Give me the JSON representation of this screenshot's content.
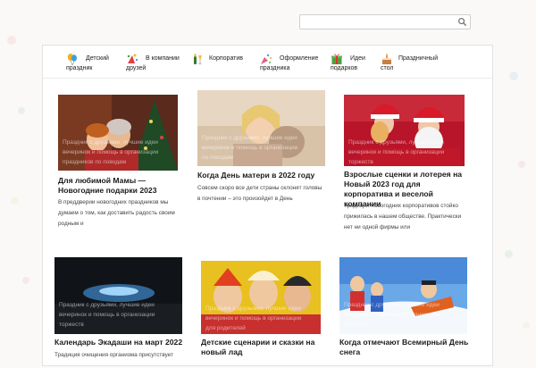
{
  "search": {
    "placeholder": "",
    "value": ""
  },
  "nav": [
    {
      "l1": "Детский",
      "l2": "праздник",
      "icon": "balloon-icon"
    },
    {
      "l1": "В компании",
      "l2": "друзей",
      "icon": "party-icon"
    },
    {
      "l1": "Корпоратив",
      "l2": "",
      "icon": "champagne-icon"
    },
    {
      "l1": "Оформление",
      "l2": "праздника",
      "icon": "confetti-icon"
    },
    {
      "l1": "Идеи",
      "l2": "подарков",
      "icon": "gift-icon"
    },
    {
      "l1": "Праздничный",
      "l2": "стол",
      "icon": "cake-icon"
    }
  ],
  "cards": [
    {
      "title1": "Для любимой Мамы —",
      "title2": "Новогодние подарки 2023",
      "title3": "",
      "exc1": "В преддверии новогодних праздников мы",
      "exc2": "думаем о том, как доставить радость своим",
      "exc3": "родным и",
      "ov1": "Праздник с друзьями, лучшие идеи",
      "ov2": "вечеринок и помощь в организации",
      "ov3": "праздников по поводам"
    },
    {
      "title1": "Когда День матери в 2022 году",
      "title2": "",
      "title3": "",
      "exc1": "Совсем скоро все дети страны склонят головы",
      "exc2": "в почтении – это произойдет в День",
      "exc3": "",
      "ov1": "Праздник с друзьями, лучшие идеи",
      "ov2": "вечеринок и помощь в организации",
      "ov3": "по поводам"
    },
    {
      "title1": "Взрослые сценки и лотерея на",
      "title2": "Новый 2023 год для",
      "title3": "корпоратива и веселой компании",
      "exc1": "Традиция новогодних корпоративов стойко",
      "exc2": "прижилась в нашем обществе. Практически",
      "exc3": "нет ни одной фирмы или",
      "ov1": "Праздник с друзьями, лучшие идеи",
      "ov2": "вечеринок и помощь в организации",
      "ov3": "торжеств"
    },
    {
      "title1": "Календарь Экадаши на март 2022",
      "title2": "",
      "title3": "",
      "exc1": "Традиция очищения организма присутствует",
      "exc2": "",
      "exc3": "",
      "ov1": "Праздник с друзьями, лучшие идеи",
      "ov2": "вечеринок и помощь в организации",
      "ov3": "торжеств"
    },
    {
      "title1": "Детские сценарии и сказки на",
      "title2": "новый лад",
      "title3": "",
      "exc1": "",
      "exc2": "",
      "exc3": "",
      "ov1": "Праздник с друзьями, лучшие идеи",
      "ov2": "вечеринок и помощь в организации",
      "ov3": "для родителей"
    },
    {
      "title1": "Когда отмечают Всемирный День",
      "title2": "снега",
      "title3": "",
      "exc1": "",
      "exc2": "",
      "exc3": "",
      "ov1": "Праздник с друзьями, лучшие идеи",
      "ov2": "вечеринок и помощь в организации",
      "ov3": "торжеств"
    }
  ]
}
